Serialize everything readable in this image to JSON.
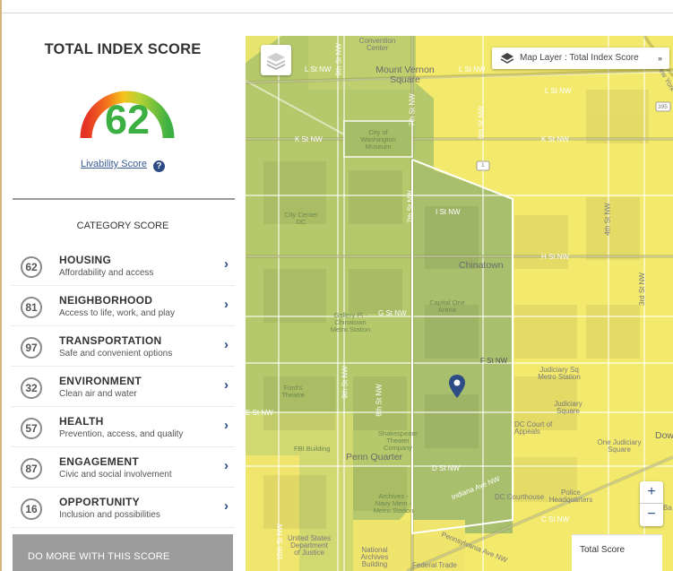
{
  "score_panel": {
    "title": "TOTAL INDEX SCORE",
    "total_score": "62",
    "livability_link": "Livability Score",
    "help_icon": "?",
    "category_title": "CATEGORY SCORE",
    "categories": [
      {
        "score": "62",
        "name": "HOUSING",
        "description": "Affordability and access"
      },
      {
        "score": "81",
        "name": "NEIGHBORHOOD",
        "description": "Access to life, work, and play"
      },
      {
        "score": "97",
        "name": "TRANSPORTATION",
        "description": "Safe and convenient options"
      },
      {
        "score": "32",
        "name": "ENVIRONMENT",
        "description": "Clean air and water"
      },
      {
        "score": "57",
        "name": "HEALTH",
        "description": "Prevention, access, and quality"
      },
      {
        "score": "87",
        "name": "ENGAGEMENT",
        "description": "Civic and social involvement"
      },
      {
        "score": "16",
        "name": "OPPORTUNITY",
        "description": "Inclusion and possibilities"
      }
    ],
    "chevron_icon": "›",
    "more_button": "DO MORE WITH THIS SCORE"
  },
  "map": {
    "layer_control": "Map Layer : Total Index Score",
    "layer_dropdown_icon": "»",
    "zoom_in": "+",
    "zoom_out": "−",
    "legend_title": "Total Score",
    "labels": {
      "convention_center": "Convention Center",
      "l_st_nw_1": "L St NW",
      "mount_vernon_square": "Mount Vernon Square",
      "l_st_nw_2": "L St NW",
      "l_st_nw_3": "L St NW",
      "new_york": "New York",
      "k_st_nw_1": "K St NW",
      "k_st_nw_2": "K St NW",
      "city_museum": "City of Washington Museum",
      "highway_395": "395",
      "highway_1": "1",
      "city_center": "City Center DC",
      "i_st_nw": "I St NW",
      "chinatown": "Chinatown",
      "h_st_nw": "H St NW",
      "capital_one_arena": "Capital One Arena",
      "gallery_pl": "Gallery Pl - Chinatown Metro Station",
      "g_st_nw": "G St NW",
      "f_st_nw": "F St NW",
      "judiciary_sq_metro": "Judiciary Sq Metro Station",
      "judiciary_square": "Judiciary Square",
      "fords_theatre": "Ford's Theatre",
      "e_st_nw": "E St NW",
      "dc_court_of_appeals": "DC Court of Appeals",
      "one_judiciary": "One Judiciary Square",
      "fbi_building": "FBI Building",
      "shakespeare": "Shakespeare Theater Company",
      "penn_quarter": "Penn Quarter",
      "d_st_nw": "D St NW",
      "indiana_ave": "Indiana Ave NW",
      "archives_metro": "Archives - Navy Mem - Metro Station",
      "dc_courthouse": "DC Courthouse",
      "police_hq": "Police Headquarters",
      "c_st_nw": "C St NW",
      "us_department_of_justice": "United States Department of Justice",
      "national_archives": "National Archives Building",
      "federal_trade": "Federal Trade",
      "pennsylvania_ave": "Pennsylvania Ave NW",
      "ninth_st_1": "9th St NW",
      "seventh_st_1": "7th St NW",
      "sixth_st": "6th St NW",
      "ninth_st_2": "9th St NW",
      "eighth_st": "8th St NW",
      "seventh_st_2": "7th St NW",
      "tenth_st": "10th St NW",
      "fourth_st": "4th St NW",
      "third_st": "3rd St NW",
      "dow": "Dow",
      "bank": "Ba"
    }
  }
}
